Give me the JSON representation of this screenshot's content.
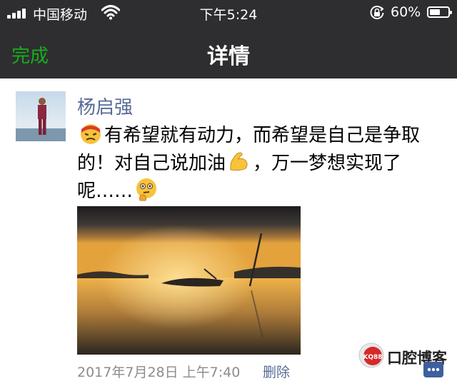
{
  "status_bar": {
    "carrier": "中国移动",
    "time": "下午5:24",
    "battery_percent": "60%",
    "battery_level": 0.6,
    "icons": [
      "signal-icon",
      "wifi-icon",
      "orientation-lock-icon",
      "battery-icon"
    ]
  },
  "nav": {
    "done_label": "完成",
    "title": "详情"
  },
  "moment": {
    "username": "杨启强",
    "text_part1": "有希望就有动力，而希望是自己是争取的！对自己说加油",
    "text_part2": "，万一梦想实现了呢……",
    "emojis": [
      "cursing-face-emoji",
      "flexed-biceps-emoji",
      "thinking-face-emoji"
    ],
    "date": "2017年7月28日 上午7:40",
    "delete_label": "删除"
  },
  "watermark": {
    "logo_text": "KQ88",
    "text": "口腔博客"
  },
  "colors": {
    "nav_bg": "#2e2e31",
    "done_green": "#1aad19",
    "link_blue": "#576b95",
    "meta_gray": "#8c8c8c"
  }
}
